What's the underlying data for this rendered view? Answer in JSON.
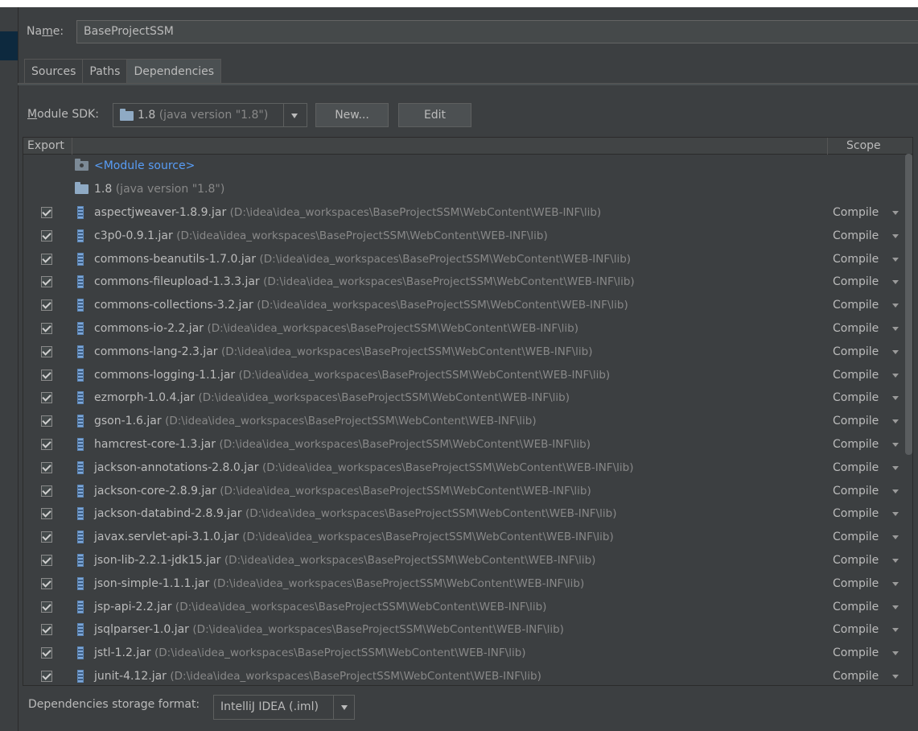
{
  "name_label": "Name:",
  "name_value": "BaseProjectSSM",
  "tabs": [
    {
      "label": "Sources",
      "active": false
    },
    {
      "label": "Paths",
      "active": false
    },
    {
      "label": "Dependencies",
      "active": true
    }
  ],
  "sdk": {
    "label": "Module SDK:",
    "version": "1.8",
    "version_extra": "(java version \"1.8\")",
    "new_button": "New...",
    "edit_button": "Edit"
  },
  "table": {
    "col_export": "Export",
    "col_scope": "Scope",
    "module_source": "<Module source>",
    "jdk_entry": {
      "name": "1.8",
      "extra": "(java version \"1.8\")"
    },
    "rows": [
      {
        "name": "aspectjweaver-1.8.9.jar",
        "path": "(D:\\idea\\idea_workspaces\\BaseProjectSSM\\WebContent\\WEB-INF\\lib)",
        "scope": "Compile",
        "exported": true
      },
      {
        "name": "c3p0-0.9.1.jar",
        "path": "(D:\\idea\\idea_workspaces\\BaseProjectSSM\\WebContent\\WEB-INF\\lib)",
        "scope": "Compile",
        "exported": true
      },
      {
        "name": "commons-beanutils-1.7.0.jar",
        "path": "(D:\\idea\\idea_workspaces\\BaseProjectSSM\\WebContent\\WEB-INF\\lib)",
        "scope": "Compile",
        "exported": true
      },
      {
        "name": "commons-fileupload-1.3.3.jar",
        "path": "(D:\\idea\\idea_workspaces\\BaseProjectSSM\\WebContent\\WEB-INF\\lib)",
        "scope": "Compile",
        "exported": true
      },
      {
        "name": "commons-collections-3.2.jar",
        "path": "(D:\\idea\\idea_workspaces\\BaseProjectSSM\\WebContent\\WEB-INF\\lib)",
        "scope": "Compile",
        "exported": true
      },
      {
        "name": "commons-io-2.2.jar",
        "path": "(D:\\idea\\idea_workspaces\\BaseProjectSSM\\WebContent\\WEB-INF\\lib)",
        "scope": "Compile",
        "exported": true
      },
      {
        "name": "commons-lang-2.3.jar",
        "path": "(D:\\idea\\idea_workspaces\\BaseProjectSSM\\WebContent\\WEB-INF\\lib)",
        "scope": "Compile",
        "exported": true
      },
      {
        "name": "commons-logging-1.1.jar",
        "path": "(D:\\idea\\idea_workspaces\\BaseProjectSSM\\WebContent\\WEB-INF\\lib)",
        "scope": "Compile",
        "exported": true
      },
      {
        "name": "ezmorph-1.0.4.jar",
        "path": "(D:\\idea\\idea_workspaces\\BaseProjectSSM\\WebContent\\WEB-INF\\lib)",
        "scope": "Compile",
        "exported": true
      },
      {
        "name": "gson-1.6.jar",
        "path": "(D:\\idea\\idea_workspaces\\BaseProjectSSM\\WebContent\\WEB-INF\\lib)",
        "scope": "Compile",
        "exported": true
      },
      {
        "name": "hamcrest-core-1.3.jar",
        "path": "(D:\\idea\\idea_workspaces\\BaseProjectSSM\\WebContent\\WEB-INF\\lib)",
        "scope": "Compile",
        "exported": true
      },
      {
        "name": "jackson-annotations-2.8.0.jar",
        "path": "(D:\\idea\\idea_workspaces\\BaseProjectSSM\\WebContent\\WEB-INF\\lib)",
        "scope": "Compile",
        "exported": true
      },
      {
        "name": "jackson-core-2.8.9.jar",
        "path": "(D:\\idea\\idea_workspaces\\BaseProjectSSM\\WebContent\\WEB-INF\\lib)",
        "scope": "Compile",
        "exported": true
      },
      {
        "name": "jackson-databind-2.8.9.jar",
        "path": "(D:\\idea\\idea_workspaces\\BaseProjectSSM\\WebContent\\WEB-INF\\lib)",
        "scope": "Compile",
        "exported": true
      },
      {
        "name": "javax.servlet-api-3.1.0.jar",
        "path": "(D:\\idea\\idea_workspaces\\BaseProjectSSM\\WebContent\\WEB-INF\\lib)",
        "scope": "Compile",
        "exported": true
      },
      {
        "name": "json-lib-2.2.1-jdk15.jar",
        "path": "(D:\\idea\\idea_workspaces\\BaseProjectSSM\\WebContent\\WEB-INF\\lib)",
        "scope": "Compile",
        "exported": true
      },
      {
        "name": "json-simple-1.1.1.jar",
        "path": "(D:\\idea\\idea_workspaces\\BaseProjectSSM\\WebContent\\WEB-INF\\lib)",
        "scope": "Compile",
        "exported": true
      },
      {
        "name": "jsp-api-2.2.jar",
        "path": "(D:\\idea\\idea_workspaces\\BaseProjectSSM\\WebContent\\WEB-INF\\lib)",
        "scope": "Compile",
        "exported": true
      },
      {
        "name": "jsqlparser-1.0.jar",
        "path": "(D:\\idea\\idea_workspaces\\BaseProjectSSM\\WebContent\\WEB-INF\\lib)",
        "scope": "Compile",
        "exported": true
      },
      {
        "name": "jstl-1.2.jar",
        "path": "(D:\\idea\\idea_workspaces\\BaseProjectSSM\\WebContent\\WEB-INF\\lib)",
        "scope": "Compile",
        "exported": true
      },
      {
        "name": "junit-4.12.jar",
        "path": "(D:\\idea\\idea_workspaces\\BaseProjectSSM\\WebContent\\WEB-INF\\lib)",
        "scope": "Compile",
        "exported": true
      }
    ]
  },
  "storage": {
    "label": "Dependencies storage format:",
    "value": "IntelliJ IDEA (.iml)"
  },
  "colors": {
    "background": "#3c3f41",
    "text": "#bbbbbb",
    "path_text": "#888888",
    "link_blue": "#589df6",
    "jar_icon": "#7ea7d8"
  }
}
